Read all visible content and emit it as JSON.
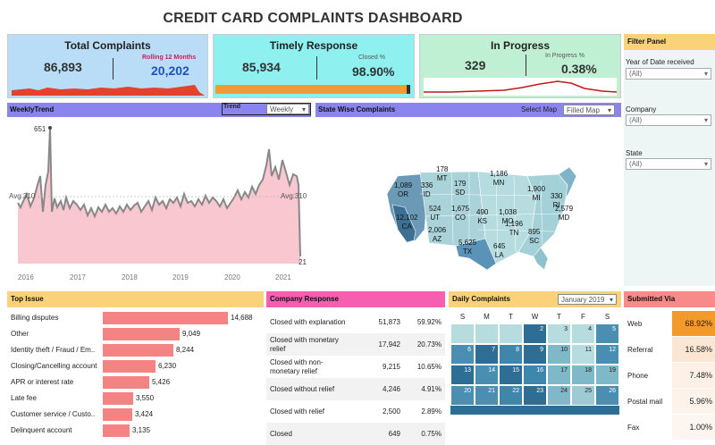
{
  "title": "CREDIT CARD COMPLAINTS DASHBOARD",
  "total": {
    "title": "Total Complaints",
    "value": "86,893",
    "rolling_label": "Rolling 12 Months",
    "rolling_value": "20,202"
  },
  "timely": {
    "title": "Timely Response",
    "value": "85,934",
    "closed_label": "Closed %",
    "closed_value": "98.90%"
  },
  "progress": {
    "title": "In Progress",
    "value": "329",
    "pct_label": "In Progress %",
    "pct_value": "0.38%"
  },
  "filter": {
    "title": "Filter Panel",
    "year_label": "Year of Date received",
    "year_value": "(All)",
    "company_label": "Company",
    "company_value": "(All)",
    "state_label": "State",
    "state_value": "(All)"
  },
  "weekly": {
    "title": "WeeklyTrend",
    "trend_label": "Trend",
    "trend_value": "Weekly",
    "avg_left": "Avg:310",
    "avg_right": "Avg:310",
    "max_label": "651",
    "min_label": "21",
    "years": [
      "2016",
      "2017",
      "2018",
      "2019",
      "2020",
      "2021"
    ]
  },
  "state": {
    "title": "State Wise Complaints",
    "select_label": "Select Map",
    "select_value": "Filled Map",
    "labels": [
      {
        "v": "178",
        "s": "MT"
      },
      {
        "v": "1,186",
        "s": "MN"
      },
      {
        "v": "1,089",
        "s": "OR"
      },
      {
        "v": "336",
        "s": "ID"
      },
      {
        "v": "179",
        "s": "SD"
      },
      {
        "v": "1,900",
        "s": "MI"
      },
      {
        "v": "330",
        "s": "RI"
      },
      {
        "v": "524",
        "s": "UT"
      },
      {
        "v": "1,675",
        "s": "CO"
      },
      {
        "v": "490",
        "s": "KS"
      },
      {
        "v": "1,038",
        "s": "MO"
      },
      {
        "v": "2,579",
        "s": "MD"
      },
      {
        "v": "12,102",
        "s": "CA"
      },
      {
        "v": "2,006",
        "s": "AZ"
      },
      {
        "v": "1,196",
        "s": "TN"
      },
      {
        "v": "895",
        "s": "SC"
      },
      {
        "v": "5,625",
        "s": "TX"
      },
      {
        "v": "645",
        "s": "LA"
      }
    ]
  },
  "top_issue": {
    "title": "Top Issue",
    "items": [
      {
        "label": "Billing disputes",
        "value": "14,688",
        "n": 14688
      },
      {
        "label": "Other",
        "value": "9,049",
        "n": 9049
      },
      {
        "label": "Identity theft / Fraud / Em..",
        "value": "8,244",
        "n": 8244
      },
      {
        "label": "Closing/Cancelling account",
        "value": "6,230",
        "n": 6230
      },
      {
        "label": "APR or interest rate",
        "value": "5,426",
        "n": 5426
      },
      {
        "label": "Late fee",
        "value": "3,550",
        "n": 3550
      },
      {
        "label": "Customer service / Custo..",
        "value": "3,424",
        "n": 3424
      },
      {
        "label": "Delinquent account",
        "value": "3,135",
        "n": 3135
      }
    ]
  },
  "company_response": {
    "title": "Company Response",
    "rows": [
      {
        "label": "Closed with explanation",
        "count": "51,873",
        "pct": "59.92%"
      },
      {
        "label": "Closed with monetary relief",
        "count": "17,942",
        "pct": "20.73%"
      },
      {
        "label": "Closed with non-monetary relief",
        "count": "9,215",
        "pct": "10.65%"
      },
      {
        "label": "Closed without relief",
        "count": "4,246",
        "pct": "4.91%"
      },
      {
        "label": "Closed with relief",
        "count": "2,500",
        "pct": "2.89%"
      },
      {
        "label": "Closed",
        "count": "649",
        "pct": "0.75%"
      }
    ]
  },
  "daily": {
    "title": "Daily Complaints",
    "month": "January 2019",
    "days": [
      "S",
      "M",
      "T",
      "W",
      "T",
      "F",
      "S"
    ]
  },
  "submitted": {
    "title": "Submitted Via",
    "rows": [
      {
        "label": "Web",
        "pct": "68.92%",
        "color": "#f39a2a"
      },
      {
        "label": "Referral",
        "pct": "16.58%",
        "color": "#fbe6d4"
      },
      {
        "label": "Phone",
        "pct": "7.48%",
        "color": "#fdf1e7"
      },
      {
        "label": "Postal mail",
        "pct": "5.96%",
        "color": "#fdf3ea"
      },
      {
        "label": "Fax",
        "pct": "1.00%",
        "color": "#fdf6f0"
      }
    ]
  },
  "colors": {
    "kpi1": "#b9ddf7",
    "kpi2": "#8ff0f0",
    "kpi3": "#bff0d4",
    "filter": "#fbd27a",
    "weekly": "#8a84ee",
    "state": "#8a84ee",
    "top": "#fbd27a",
    "company": "#f65fb0",
    "daily": "#fbd27a",
    "submitted": "#f88a8a"
  }
}
